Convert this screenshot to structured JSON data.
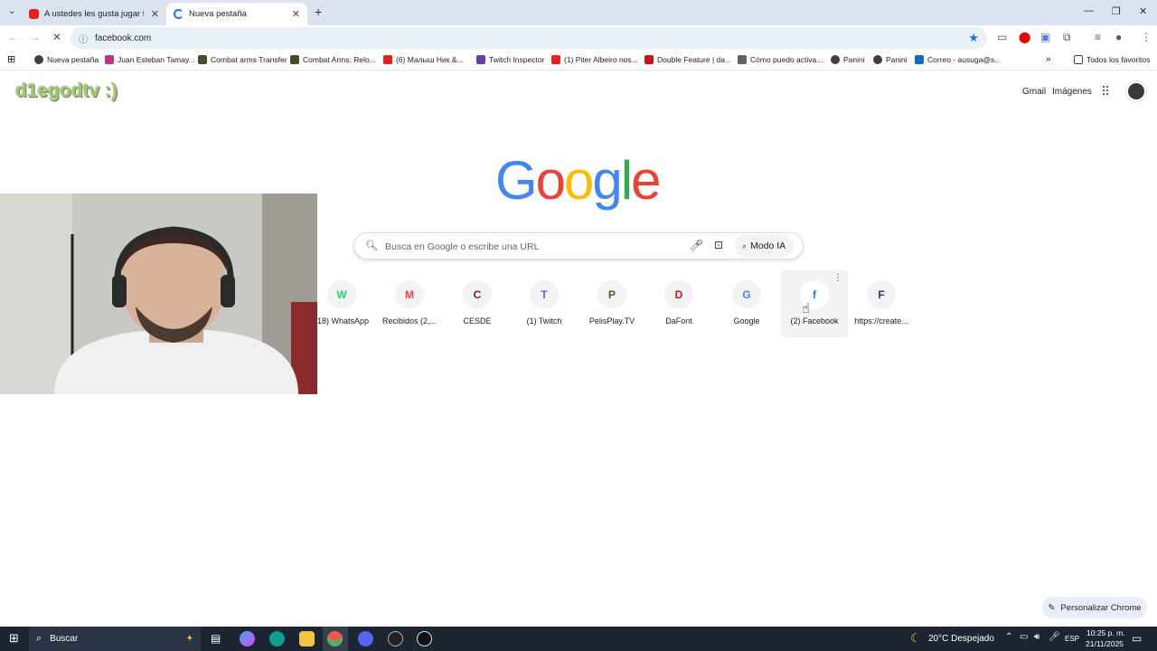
{
  "tabs": [
    {
      "title": "A ustedes les gusta jugar torne",
      "active": false
    },
    {
      "title": "Nueva pestaña",
      "active": true
    }
  ],
  "toolbar": {
    "url": "facebook.com"
  },
  "bookmarks": [
    {
      "label": "Nueva pestaña",
      "color": "#3c4043"
    },
    {
      "label": "Juan Esteban Tamay...",
      "color": "#c13584"
    },
    {
      "label": "Combat arms Transfer",
      "color": "#4a4a2a"
    },
    {
      "label": "Combat Arms: Relo...",
      "color": "#4a4a2a"
    },
    {
      "label": "(6) Малыш Ник &...",
      "color": "#e62117"
    },
    {
      "label": "Twitch Inspector",
      "color": "#6441a5"
    },
    {
      "label": "(1) Piter Albeiro nos...",
      "color": "#e62117"
    },
    {
      "label": "Double Feature | da...",
      "color": "#c4161c"
    },
    {
      "label": "Cómo puedo activa...",
      "color": "#5f6368"
    },
    {
      "label": "Panini",
      "color": "#3c4043"
    },
    {
      "label": "Panini",
      "color": "#3c4043"
    },
    {
      "label": "Correo - ausuga@s...",
      "color": "#0f6cbd"
    }
  ],
  "bookmarks_all": "Todos los favoritos",
  "page": {
    "links": {
      "gmail": "Gmail",
      "images": "Imágenes"
    },
    "watermark": "d1egodtv :)",
    "logo_letters": [
      {
        "ch": "G",
        "color": "#4285f4"
      },
      {
        "ch": "o",
        "color": "#ea4335"
      },
      {
        "ch": "o",
        "color": "#fbbc05"
      },
      {
        "ch": "g",
        "color": "#4285f4"
      },
      {
        "ch": "l",
        "color": "#34a853"
      },
      {
        "ch": "e",
        "color": "#ea4335"
      }
    ],
    "search_placeholder": "Busca en Google o escribe una URL",
    "ai_mode": "Modo IA",
    "shortcuts": [
      {
        "label": "(18) WhatsApp",
        "glyph": "W",
        "color": "#25d366"
      },
      {
        "label": "Recibidos (2,...",
        "glyph": "M",
        "color": "#ea4335"
      },
      {
        "label": "CESDE",
        "glyph": "C",
        "color": "#7b1e1e"
      },
      {
        "label": "(1) Twitch",
        "glyph": "T",
        "color": "#9146ff"
      },
      {
        "label": "PelisPlay.TV",
        "glyph": "P",
        "color": "#5a5a1e"
      },
      {
        "label": "DaFont",
        "glyph": "D",
        "color": "#c4161c"
      },
      {
        "label": "Google",
        "glyph": "G",
        "color": "#4285f4"
      },
      {
        "label": "(2) Facebook",
        "glyph": "f",
        "color": "#1877f2"
      },
      {
        "label": "https://create...",
        "glyph": "F",
        "color": "#3b2a7a"
      }
    ],
    "customize": "Personalizar Chrome"
  },
  "taskbar": {
    "search": "Buscar",
    "weather": "20°C Despejado",
    "lang": "ESP",
    "time": "10:25 p. m.",
    "date": "21/11/2025"
  }
}
